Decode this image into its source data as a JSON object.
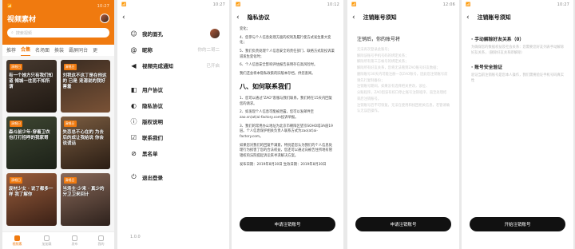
{
  "status_time_a": "10:27",
  "status_time_b": "10:12",
  "status_time_c": "12:06",
  "status_time_d": "10:27",
  "screen1": {
    "title": "视频素材",
    "search_placeholder": "搜索视频",
    "tabs": [
      "推荐",
      "合集",
      "名场面",
      "换装",
      "霸屏同台",
      "更"
    ],
    "active_tab": "合集",
    "cards": [
      {
        "label": "演唱日",
        "caption": "有一个她方只有我们知道 倾城一往而不知所谓"
      },
      {
        "label": "演唱日",
        "caption": "刘我这不这丁是在他这的 已是 宠溺说的我好害羞"
      },
      {
        "label": "演唱日",
        "caption": "森斗前少年·穿着卫衣也打打招呼的我家哥"
      },
      {
        "label": "演唱日",
        "caption": "失恋总不心在的 为去后的成让我给说 你会说谎话"
      },
      {
        "label": "演唱日",
        "caption": "废材少女 · 说了都多一样 我了解你"
      },
      {
        "label": "演唱日",
        "caption": "当场主·少来 · 真少的 分卫卫来回计"
      }
    ],
    "nav": [
      "视频素",
      "加加载",
      "发布",
      "我的"
    ]
  },
  "screen2": {
    "items": [
      {
        "icon": "☺",
        "label": "我的面孔",
        "value": ""
      },
      {
        "icon": "@",
        "label": "昵称",
        "value": "你的二哥二"
      },
      {
        "icon": "◀",
        "label": "视频完成通知",
        "value": "已开启"
      },
      {
        "icon": "◧",
        "label": "用户协议",
        "value": ""
      },
      {
        "icon": "◐",
        "label": "隐私协议",
        "value": ""
      },
      {
        "icon": "ⓘ",
        "label": "版权说明",
        "value": ""
      },
      {
        "icon": "☑",
        "label": "联系我们",
        "value": ""
      },
      {
        "icon": "⊘",
        "label": "黑名单",
        "value": ""
      },
      {
        "icon": "⏻",
        "label": "退出登录",
        "value": ""
      }
    ],
    "version": "1.0.0"
  },
  "screen3": {
    "title": "隐私协议",
    "paras_top": [
      "变化；",
      "4、您参与个人信息处理方面的权利及履行使方式发生重大变化；",
      "5、我们负责处理个人信息安全的责任部门、联络方式及投诉渠道发生变化时；",
      "6、个人信息安全影响评估报告表明存在高风险时。",
      "我们还会将本隐私政策的旧版本存档，供您查阅。"
    ],
    "heading": "八、如何联系我们",
    "paras_bottom": [
      "1、您可以通过\"ZAO\"客服与我们联系，我们将在15天内回复您的请求。",
      "2、如发现个人信息可能被泄露，您可以发邮件至 zao.sn(at)ai-factory.com投诉举报。",
      "3、我们的常用办公地址为北京市朝阳区望京SOHO塔3A座19层。个人信息保护相关负责人联系方式为zao(at)ai-factory.com。",
      "如果您对我们的回复不满意，特别是您认为我们的个人信息处理行为损害了您的合法权益，您还可以通过向被告住所地有管辖权的法院提起诉讼来寻求解决方案。",
      "发布日期：2019年8月30日 生效日期：2019年8月30日"
    ],
    "button": "申请注销账号"
  },
  "screen4": {
    "title": "注销账号须知",
    "lead": "注销后，你的账号将",
    "lines": [
      "无法再次登录此账号；",
      "解除该账号手机号码的绑定关系；",
      "解除所有第三方帐号的绑定关系；",
      "解除所有好友关系，您将无法看到ZAO账号好友数据；",
      "删除账号30天内可能注册一次ZAO账号，因此您注销账号前请先行复制备份；",
      "注销账号期间，如果没有选择把关更改，该位、",
      "分账程序，ZAO因该有权口停止账号注销程序，直至处理结束后注销账号。",
      "注销账号后不可恢复，无法在使用和找回相关信息，若管请确认无误后操作。"
    ],
    "button": "申请注销账号"
  },
  "screen5": {
    "title": "注销账号须知",
    "sections": [
      {
        "head": "· 手动解除好友关系（0）",
        "desc": "为确保您的数据权益及社会关系：您需要您好友列表手动解除好友关系，（删除好友关系即解除）"
      },
      {
        "head": "· 账号安全验证",
        "desc": "验证当前注销账号是您本人操作，我们需要验证手机号码真实性"
      }
    ],
    "button": "开始注销账号"
  }
}
